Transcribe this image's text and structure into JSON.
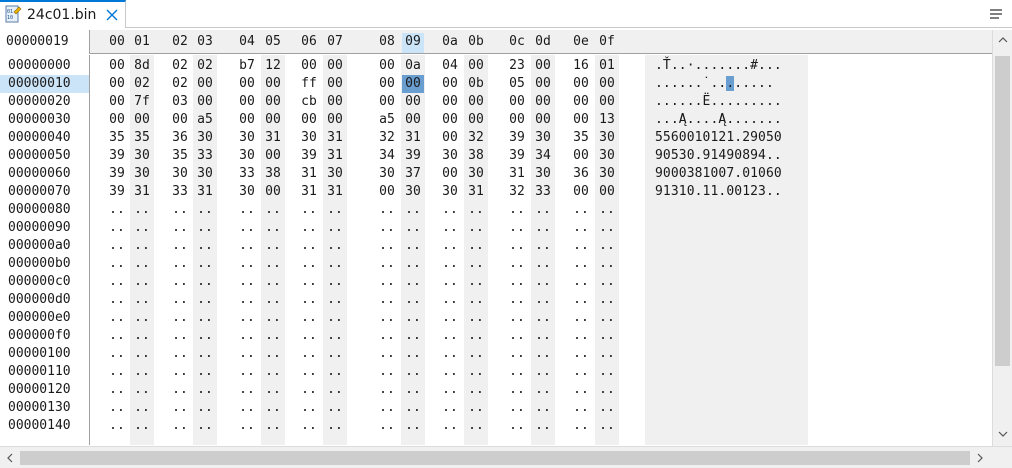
{
  "tab": {
    "title": "24c01.bin",
    "icon": "binary-file-icon"
  },
  "header": {
    "current_offset": "00000019",
    "columns": [
      "00",
      "01",
      "02",
      "03",
      "04",
      "05",
      "06",
      "07",
      "08",
      "09",
      "0a",
      "0b",
      "0c",
      "0d",
      "0e",
      "0f"
    ],
    "selected_column": 9
  },
  "addresses": [
    "00000000",
    "00000010",
    "00000020",
    "00000030",
    "00000040",
    "00000050",
    "00000060",
    "00000070",
    "00000080",
    "00000090",
    "000000a0",
    "000000b0",
    "000000c0",
    "000000d0",
    "000000e0",
    "000000f0",
    "00000100",
    "00000110",
    "00000120",
    "00000130",
    "00000140"
  ],
  "selected_address_row": 1,
  "rows": [
    [
      "00",
      "8d",
      "02",
      "02",
      "b7",
      "12",
      "00",
      "00",
      "00",
      "0a",
      "04",
      "00",
      "23",
      "00",
      "16",
      "01"
    ],
    [
      "00",
      "02",
      "02",
      "00",
      "00",
      "00",
      "ff",
      "00",
      "00",
      "00",
      "00",
      "0b",
      "05",
      "00",
      "00",
      "00"
    ],
    [
      "00",
      "7f",
      "03",
      "00",
      "00",
      "00",
      "cb",
      "00",
      "00",
      "00",
      "00",
      "00",
      "00",
      "00",
      "00",
      "00"
    ],
    [
      "00",
      "00",
      "00",
      "a5",
      "00",
      "00",
      "00",
      "00",
      "a5",
      "00",
      "00",
      "00",
      "00",
      "00",
      "00",
      "13"
    ],
    [
      "35",
      "35",
      "36",
      "30",
      "30",
      "31",
      "30",
      "31",
      "32",
      "31",
      "00",
      "32",
      "39",
      "30",
      "35",
      "30"
    ],
    [
      "39",
      "30",
      "35",
      "33",
      "30",
      "00",
      "39",
      "31",
      "34",
      "39",
      "30",
      "38",
      "39",
      "34",
      "00",
      "30"
    ],
    [
      "39",
      "30",
      "30",
      "30",
      "33",
      "38",
      "31",
      "30",
      "30",
      "37",
      "00",
      "30",
      "31",
      "30",
      "36",
      "30"
    ],
    [
      "39",
      "31",
      "33",
      "31",
      "30",
      "00",
      "31",
      "31",
      "00",
      "30",
      "30",
      "31",
      "32",
      "33",
      "00",
      "00"
    ]
  ],
  "selected_cell": {
    "row": 1,
    "col": 9
  },
  "empty_cell": "..",
  "ascii": [
    ".Ť..·.......#...",
    "......˙..",
    "......Ë.........",
    "...Ą....Ą.......",
    "5560010121.29050",
    "90530.91490894..",
    "9000381007.01060",
    "91310.11.00123.."
  ],
  "ascii_sel_row_tail": ".....",
  "ascii_sel_char": ".",
  "colors": {
    "selection": "#6a9ed1",
    "header_highlight": "#cce4f7",
    "accent": "#0078d7"
  }
}
